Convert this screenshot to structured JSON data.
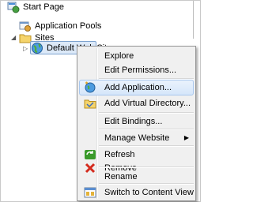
{
  "tree": {
    "start_page": "Start Page",
    "app_pools": "Application Pools",
    "sites": "Sites",
    "default_site": "Default Web Site"
  },
  "menu": {
    "explore": "Explore",
    "edit_permissions": "Edit Permissions...",
    "add_application": "Add Application...",
    "add_virtual_directory": "Add Virtual Directory...",
    "edit_bindings": "Edit Bindings...",
    "manage_website": "Manage Website",
    "refresh": "Refresh",
    "remove": "Remove",
    "rename": "Rename",
    "switch_content_view": "Switch to Content View"
  },
  "colors": {
    "selection_fill": "#dce9f8",
    "selection_border": "#7da2ce",
    "menu_background": "#f0f0f0",
    "remove_icon": "#d42b1e",
    "refresh_icon": "#3a9a2b"
  }
}
